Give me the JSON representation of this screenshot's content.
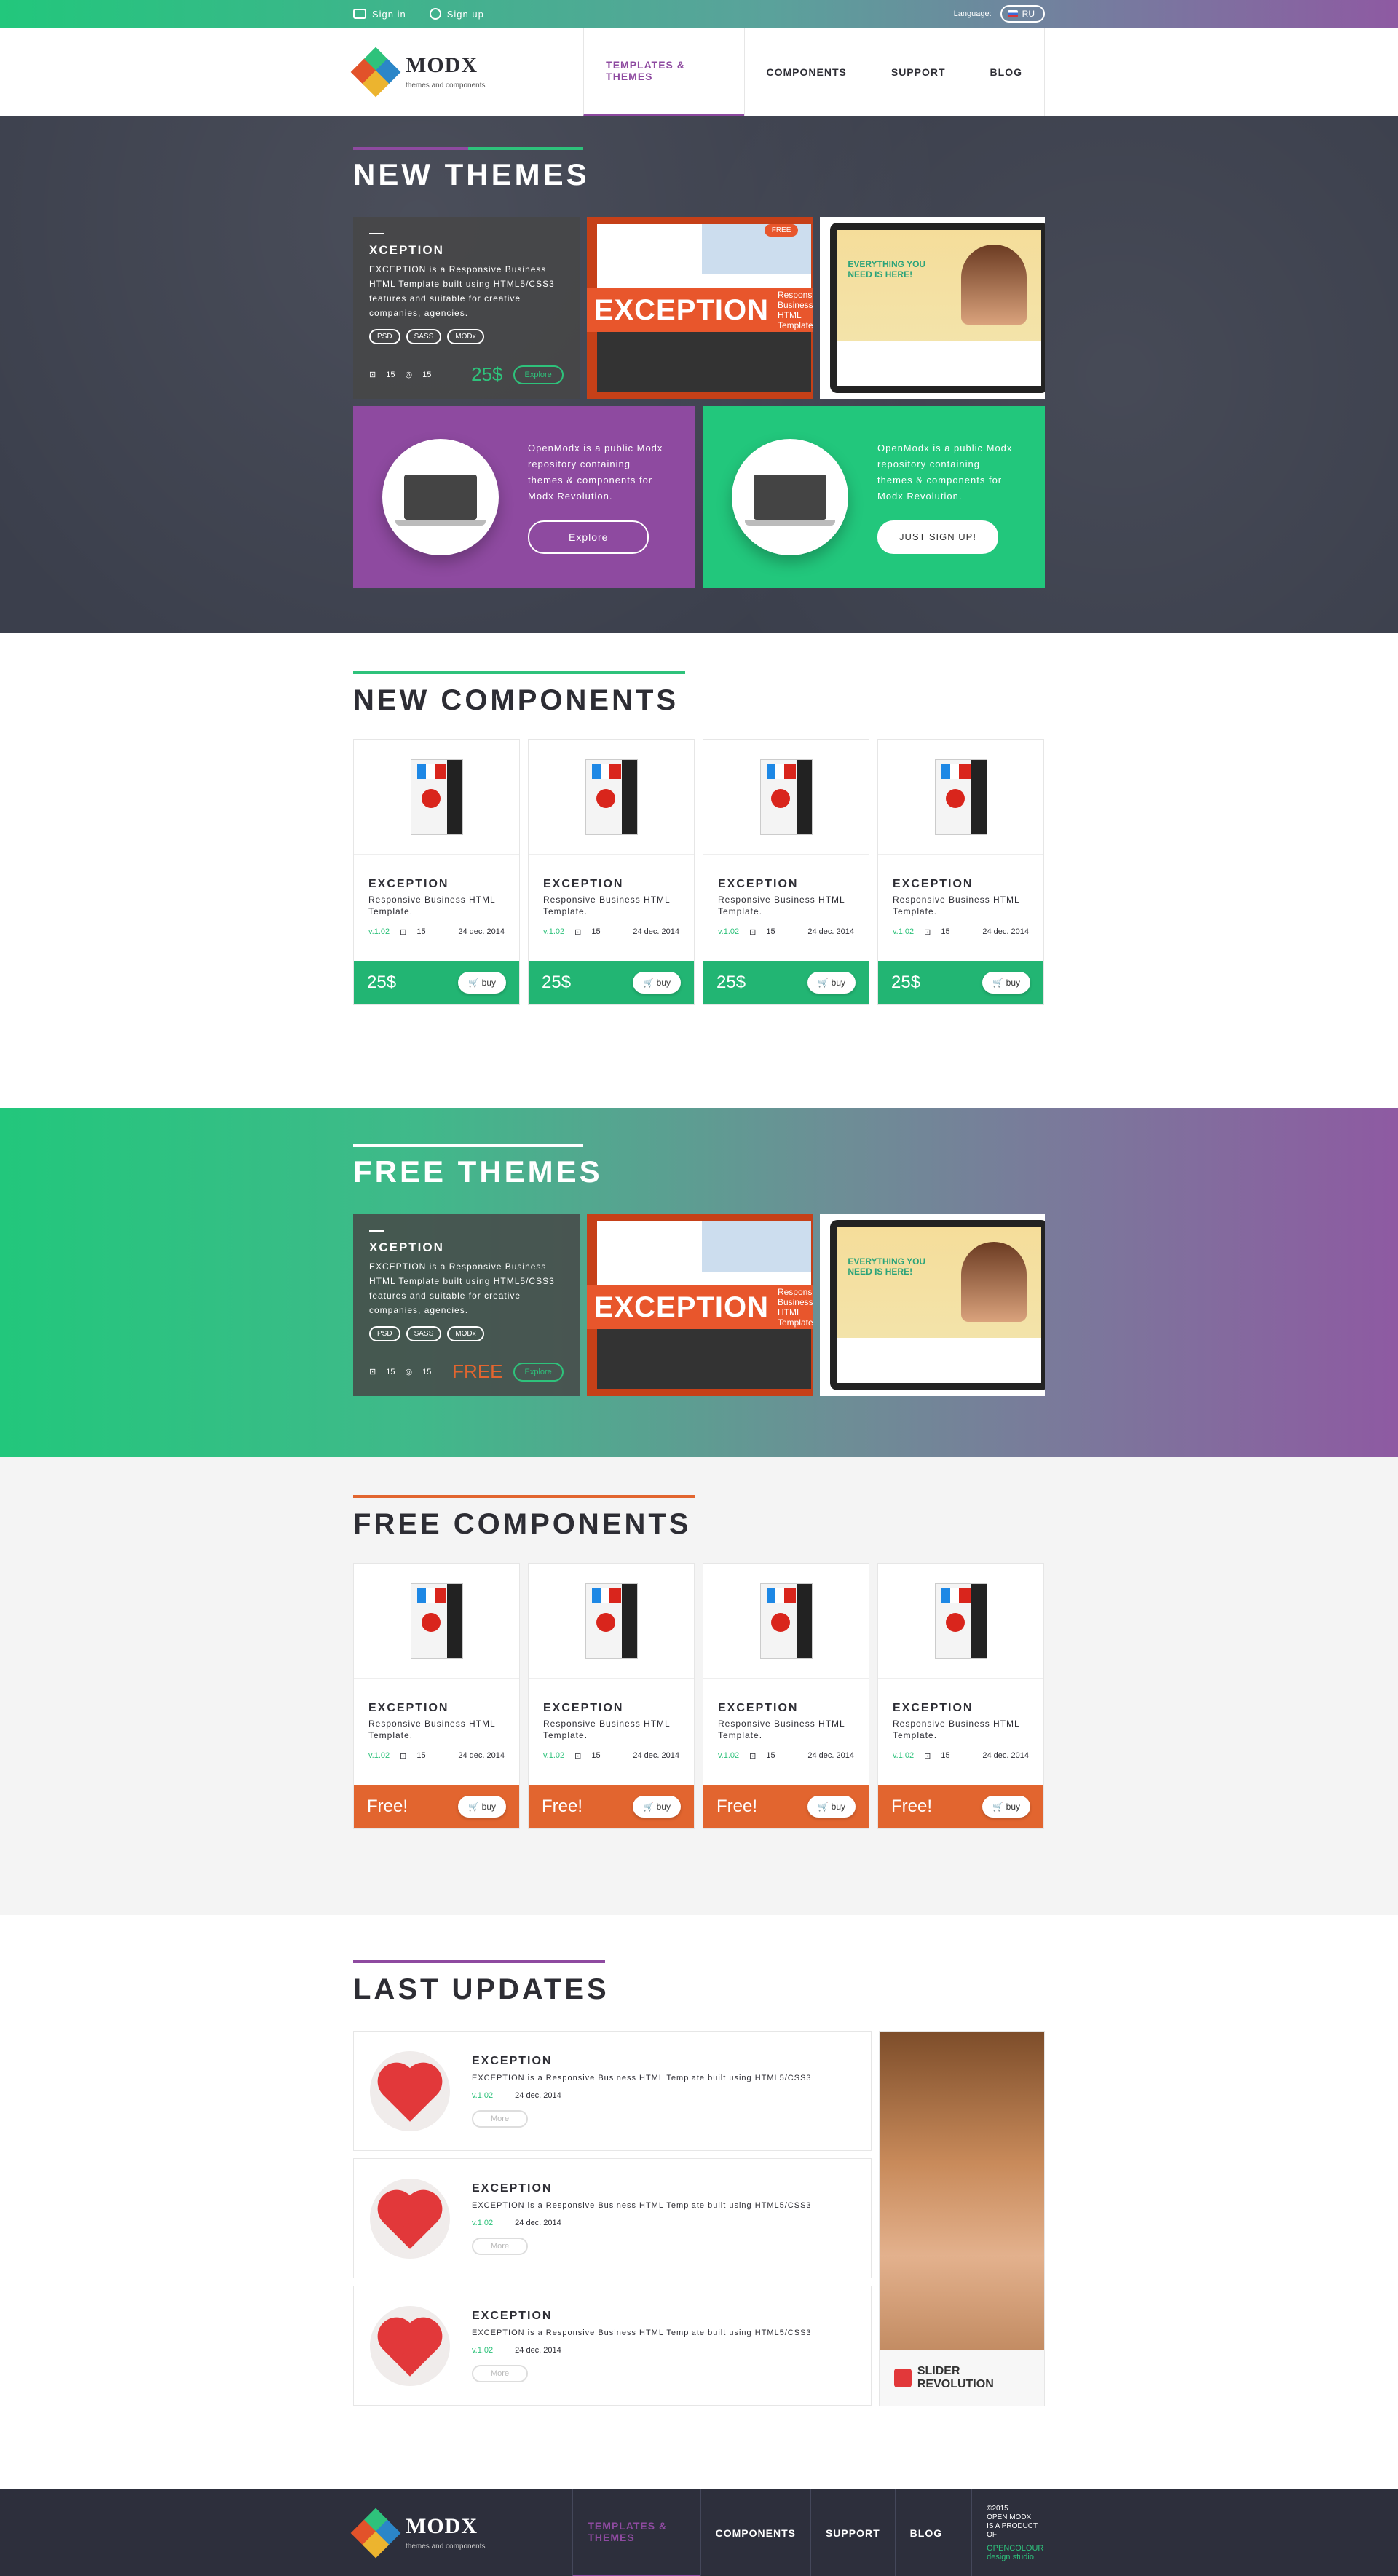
{
  "topbar": {
    "signin": "Sign in",
    "signup": "Sign up",
    "language_label": "Language:",
    "language": "RU"
  },
  "brand": {
    "name": "MODX",
    "tagline": "themes and components"
  },
  "nav": [
    {
      "label": "TEMPLATES & THEMES",
      "active": true
    },
    {
      "label": "COMPONENTS"
    },
    {
      "label": "SUPPORT"
    },
    {
      "label": "BLOG"
    }
  ],
  "colors": {
    "green": "#22c77c",
    "purple": "#8e4aa0",
    "orange": "#e2652f",
    "dark": "#2d2f3c"
  },
  "new_themes": {
    "title": "NEW THEMES",
    "featured": {
      "name": "XCEPTION",
      "desc": "EXCEPTION is a Responsive Business HTML Template built using HTML5/CSS3 features and suitable for creative companies, agencies.",
      "tags": [
        "PSD",
        "SASS",
        "MODx"
      ],
      "downloads": "15",
      "views": "15",
      "price": "25$",
      "explore": "Explore"
    },
    "shot1": {
      "banner": "EXCEPTION",
      "sub": "Responsive Business HTML Template",
      "free": "FREE"
    },
    "shot2": {
      "headline": "EVERYTHING YOU NEED IS HERE!"
    },
    "promo1": {
      "text": "OpenModx is a public Modx repository containing themes & components for Modx Revolution.",
      "button": "Explore"
    },
    "promo2": {
      "text": "OpenModx is a public Modx repository containing themes & components for Modx Revolution.",
      "button": "JUST SIGN UP!"
    }
  },
  "new_components": {
    "title": "NEW COMPONENTS",
    "items": [
      {
        "name": "EXCEPTION",
        "desc": "Responsive Business HTML Template.",
        "version": "v.1.02",
        "count": "15",
        "date": "24 dec. 2014",
        "price": "25$",
        "buy": "buy"
      },
      {
        "name": "EXCEPTION",
        "desc": "Responsive Business HTML Template.",
        "version": "v.1.02",
        "count": "15",
        "date": "24 dec. 2014",
        "price": "25$",
        "buy": "buy"
      },
      {
        "name": "EXCEPTION",
        "desc": "Responsive Business HTML Template.",
        "version": "v.1.02",
        "count": "15",
        "date": "24 dec. 2014",
        "price": "25$",
        "buy": "buy"
      },
      {
        "name": "EXCEPTION",
        "desc": "Responsive Business HTML Template.",
        "version": "v.1.02",
        "count": "15",
        "date": "24 dec. 2014",
        "price": "25$",
        "buy": "buy"
      }
    ]
  },
  "free_themes": {
    "title": "FREE THEMES",
    "featured": {
      "name": "XCEPTION",
      "desc": "EXCEPTION is a Responsive Business HTML Template built using HTML5/CSS3 features and suitable for creative companies, agencies.",
      "tags": [
        "PSD",
        "SASS",
        "MODx"
      ],
      "downloads": "15",
      "views": "15",
      "price": "FREE",
      "explore": "Explore"
    },
    "shot1": {
      "banner": "EXCEPTION",
      "sub": "Responsive Business HTML Template"
    },
    "shot2": {
      "headline": "EVERYTHING YOU NEED IS HERE!"
    }
  },
  "free_components": {
    "title": "FREE COMPONENTS",
    "items": [
      {
        "name": "EXCEPTION",
        "desc": "Responsive Business HTML Template.",
        "version": "v.1.02",
        "count": "15",
        "date": "24 dec. 2014",
        "price": "Free!",
        "buy": "buy"
      },
      {
        "name": "EXCEPTION",
        "desc": "Responsive Business HTML Template.",
        "version": "v.1.02",
        "count": "15",
        "date": "24 dec. 2014",
        "price": "Free!",
        "buy": "buy"
      },
      {
        "name": "EXCEPTION",
        "desc": "Responsive Business HTML Template.",
        "version": "v.1.02",
        "count": "15",
        "date": "24 dec. 2014",
        "price": "Free!",
        "buy": "buy"
      },
      {
        "name": "EXCEPTION",
        "desc": "Responsive Business HTML Template.",
        "version": "v.1.02",
        "count": "15",
        "date": "24 dec. 2014",
        "price": "Free!",
        "buy": "buy"
      }
    ]
  },
  "last_updates": {
    "title": "LAST UPDATES",
    "items": [
      {
        "name": "EXCEPTION",
        "desc": "EXCEPTION is a Responsive Business HTML Template built using HTML5/CSS3",
        "version": "v.1.02",
        "date": "24 dec. 2014",
        "more": "More"
      },
      {
        "name": "EXCEPTION",
        "desc": "EXCEPTION is a Responsive Business HTML Template built using HTML5/CSS3",
        "version": "v.1.02",
        "date": "24 dec. 2014",
        "more": "More"
      },
      {
        "name": "EXCEPTION",
        "desc": "EXCEPTION is a Responsive Business HTML Template built using HTML5/CSS3",
        "version": "v.1.02",
        "date": "24 dec. 2014",
        "more": "More"
      }
    ],
    "ad": "SLIDER REVOLUTION"
  },
  "footer": {
    "nav": [
      "TEMPLATES & THEMES",
      "COMPONENTS",
      "SUPPORT",
      "BLOG"
    ],
    "copy1": "©2015",
    "copy2": "OPEN MODX",
    "copy3": "IS A PRODUCT OF",
    "studio": "OPENCOLOUR",
    "studio_sub": "design studio"
  }
}
